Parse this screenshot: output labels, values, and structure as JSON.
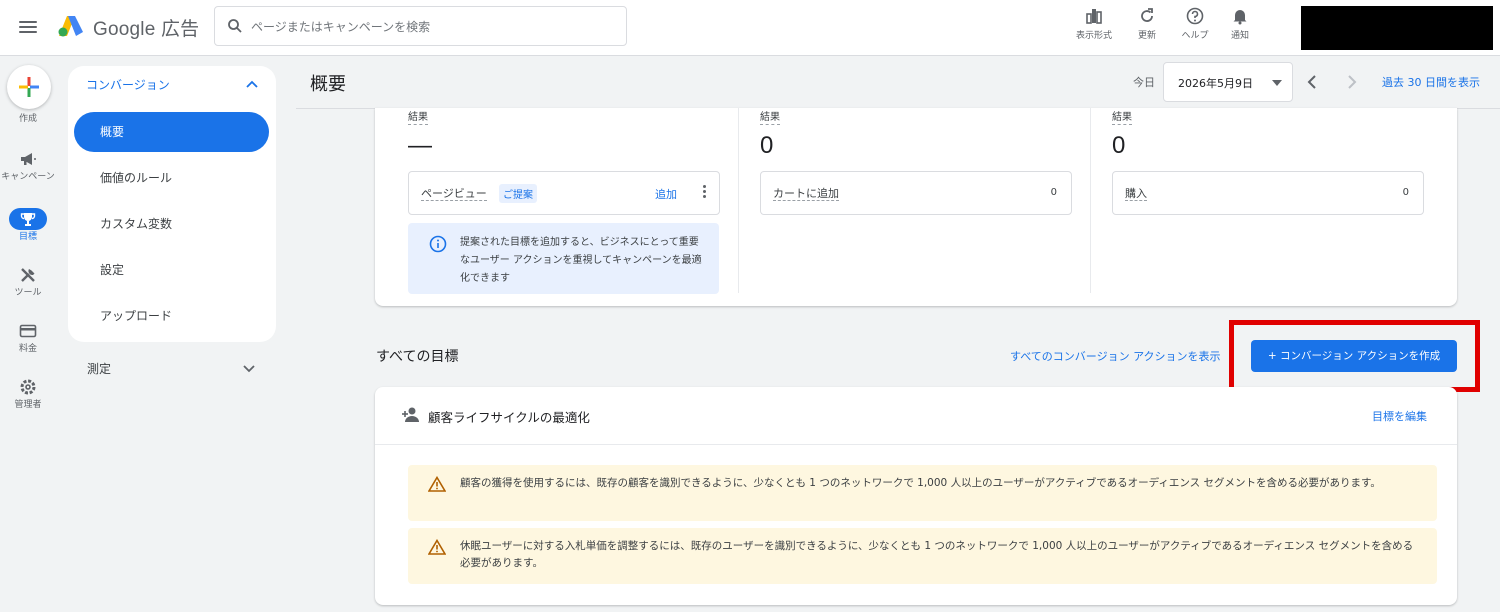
{
  "header": {
    "brand_google": "Google",
    "brand_ads": "広告",
    "search_placeholder": "ページまたはキャンペーンを検索",
    "tools": [
      {
        "label": "表示形式",
        "icon": "view-format-icon"
      },
      {
        "label": "更新",
        "icon": "refresh-icon"
      },
      {
        "label": "ヘルプ",
        "icon": "help-icon"
      },
      {
        "label": "通知",
        "icon": "bell-icon"
      }
    ]
  },
  "rail": {
    "items": [
      {
        "label": "作成",
        "icon": "plus-icon"
      },
      {
        "label": "キャンペーン",
        "icon": "megaphone-icon"
      },
      {
        "label": "目標",
        "icon": "trophy-icon",
        "active": true
      },
      {
        "label": "ツール",
        "icon": "tools-icon"
      },
      {
        "label": "料金",
        "icon": "credit-card-icon"
      },
      {
        "label": "管理者",
        "icon": "settings-icon"
      }
    ]
  },
  "subnav": {
    "section": "コンバージョン",
    "items": [
      "概要",
      "価値のルール",
      "カスタム変数",
      "設定",
      "アップロード"
    ],
    "active_index": 0,
    "measure": "測定"
  },
  "page": {
    "title": "概要",
    "today_label": "今日",
    "date_value": "2026年5月9日",
    "range_link": "過去 30 日間を表示"
  },
  "results": [
    {
      "label": "結果",
      "value": "—",
      "metric": "ページビュー",
      "chip": "ご提案",
      "action": "追加"
    },
    {
      "label": "結果",
      "value": "0",
      "metric": "カートに追加",
      "count": "0"
    },
    {
      "label": "結果",
      "value": "0",
      "metric": "購入",
      "count": "0"
    }
  ],
  "info_text": "提案された目標を追加すると、ビジネスにとって重要なユーザー アクションを重視してキャンペーンを最適化できます",
  "goals": {
    "title": "すべての目標",
    "all_link": "すべてのコンバージョン アクションを表示",
    "create_button": "+ コンバージョン アクションを作成"
  },
  "lifecycle": {
    "title": "顧客ライフサイクルの最適化",
    "edit": "目標を編集",
    "warnings": [
      "顧客の獲得を使用するには、既存の顧客を識別できるように、少なくとも 1 つのネットワークで 1,000 人以上のユーザーがアクティブであるオーディエンス セグメントを含める必要があります。",
      "休眠ユーザーに対する入札単価を調整するには、既存のユーザーを識別できるように、少なくとも 1 つのネットワークで 1,000 人以上のユーザーがアクティブであるオーディエンス セグメントを含める必要があります。"
    ]
  },
  "colors": {
    "accent": "#1a73e8",
    "highlight": "#e00000",
    "warning_bg": "#fef7e0",
    "info_bg": "#e8f0fe"
  }
}
